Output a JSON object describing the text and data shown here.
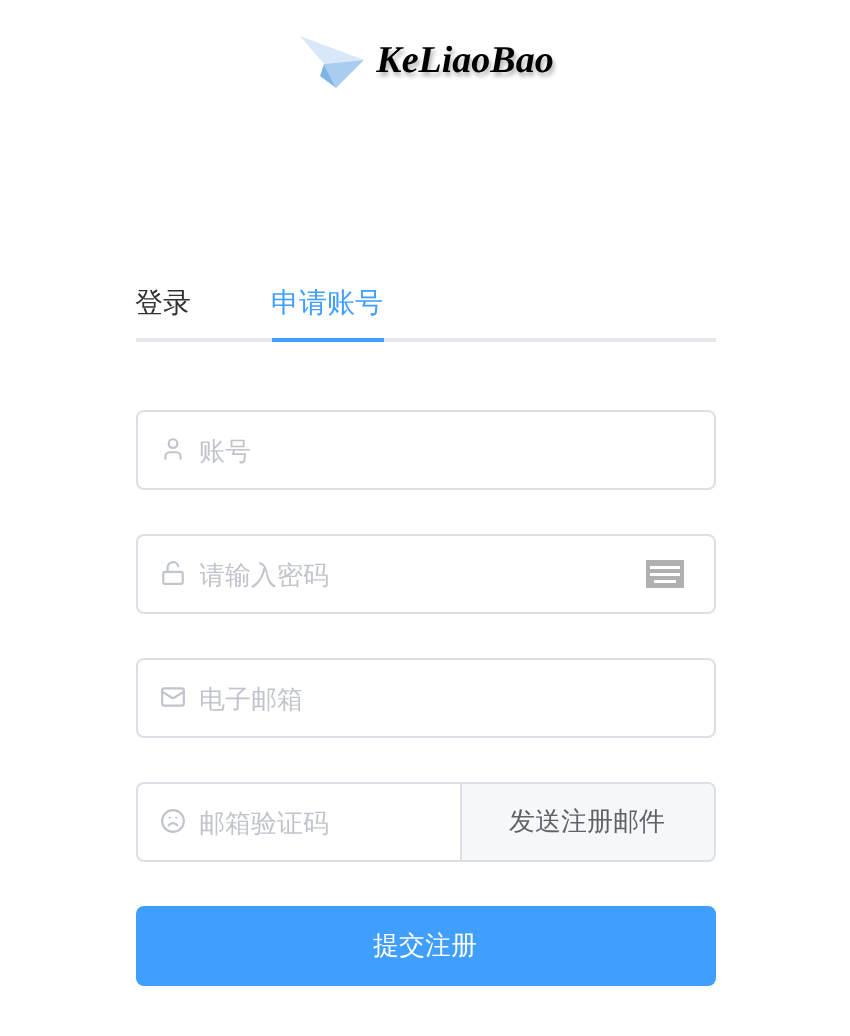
{
  "logo": {
    "text": "KeLiaoBao"
  },
  "tabs": [
    {
      "label": "登录",
      "selected": false
    },
    {
      "label": "申请账号",
      "selected": true
    }
  ],
  "fields": [
    {
      "kind": "account",
      "placeholder": "账号"
    },
    {
      "kind": "password",
      "placeholder": "请输入密码"
    },
    {
      "kind": "email",
      "placeholder": "电子邮箱"
    },
    {
      "kind": "code",
      "placeholder": "邮箱验证码",
      "button": "发送注册邮件"
    }
  ],
  "submit": "提交注册"
}
